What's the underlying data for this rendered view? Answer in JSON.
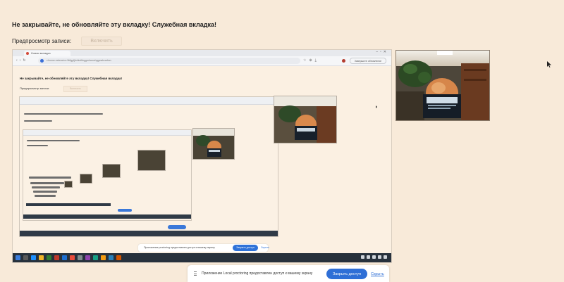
{
  "page": {
    "warning": "Не закрывайте, не обновляйте эту вкладку! Служебная вкладка!",
    "preview_label": "Предпросмотр записи:",
    "toggle_label": "Включить"
  },
  "screen_share": {
    "browser": {
      "tab_title": "Новая вкладка",
      "address": "chrome-extension://kfiggfjfohkolhbggmhamohggmakcadmn",
      "menu_label": "Завершите обновление"
    },
    "warning": "Не закрывайте, не обновляйте эту вкладку! Служебная вкладка!",
    "preview_label": "Предпросмотр записи:",
    "toggle_label": "Включить",
    "notice": {
      "text": "Приложение proctoring предоставлен доступ к вашему экрану",
      "share_label": "Закрыть доступ",
      "hide_label": "Скрыть"
    },
    "taskbar_icon_colors": [
      "#3b7ddd",
      "#5a5a5a",
      "#1e90ff",
      "#f0b429",
      "#2f7d32",
      "#c0392b",
      "#1d6fd1",
      "#e74c3c",
      "#7f8c8d",
      "#8e44ad",
      "#16a085",
      "#f39c12",
      "#2980b9",
      "#d35400"
    ]
  },
  "notification": {
    "text": "Приложение Local proctoring предоставлен доступ к вашему экрану",
    "share_label": "Закрыть доступ",
    "hide_label": "Скрыть"
  },
  "colors": {
    "page_background": "#f8ead9",
    "accent_blue": "#2f6fd6",
    "taskbar": "#27313c"
  }
}
